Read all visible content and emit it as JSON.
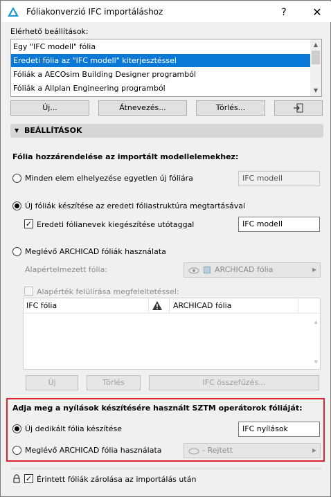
{
  "window": {
    "title": "Fóliakonverzió IFC importáláshoz",
    "help_label": "?",
    "close_label": "✕"
  },
  "presets": {
    "label": "Elérhető beállítások:",
    "items": [
      "Egy \"IFC modell\" fólia",
      "Eredeti fólia az \"IFC modell\" kiterjesztéssel",
      "Fóliák a AECOsim Building Designer programból",
      "Fóliák a Allplan Engineering programból"
    ],
    "selected_index": 1
  },
  "preset_buttons": {
    "new": "Új...",
    "rename": "Átnevezés...",
    "delete": "Törlés..."
  },
  "settings": {
    "header": "BEÁLLÍTÁSOK",
    "assign_heading": "Fólia hozzárendelése az importált modellelemekhez:",
    "opt_single": "Minden elem elhelyezése egyetlen új fóliára",
    "opt_single_value": "IFC modell",
    "opt_new_layers": "Új fóliák készítése az eredeti fóliastruktúra megtartásával",
    "suffix_label": "Eredeti fólianevek kiegészítése utótaggal",
    "suffix_value": "IFC modell",
    "opt_existing": "Meglévő ARCHICAD fóliák használata",
    "default_layer_label": "Alapértelmezett fólia:",
    "default_layer_value": "ARCHICAD fólia",
    "override_label": "Alapérték felülírása megfeleltetéssel:",
    "mapping_row": {
      "ifc": "IFC fólia",
      "archicad": "ARCHICAD fólia"
    },
    "map_buttons": {
      "new": "Új",
      "delete": "Törlés",
      "merge": "IFC összefűzés..."
    }
  },
  "openings": {
    "heading": "Adja meg a nyílások készítésére használt SZTM operátorok fóliáját:",
    "opt_new": "Új dedikált fólia készítése",
    "opt_new_value": "IFC nyílások",
    "opt_existing": "Meglévő ARCHICAD fólia használata",
    "opt_existing_value": "- Rejtett"
  },
  "lock": {
    "label": "Érintett fóliák zárolása az importálás után"
  },
  "colors": {
    "selection": "#0a78d7",
    "highlight_border": "#e0232e"
  }
}
